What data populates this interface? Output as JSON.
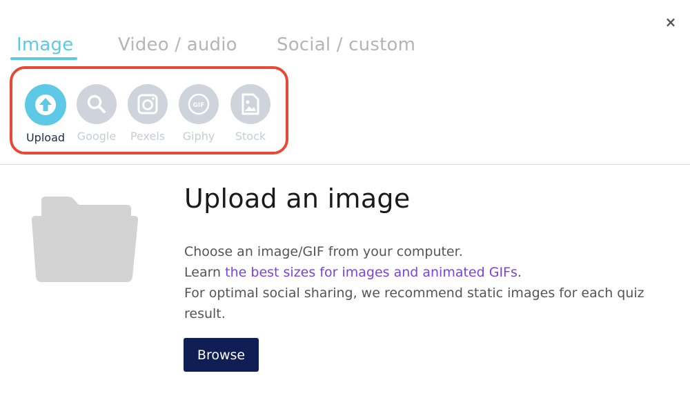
{
  "dialog": {
    "close_label": "×"
  },
  "tabs": [
    {
      "label": "Image",
      "active": true
    },
    {
      "label": "Video / audio",
      "active": false
    },
    {
      "label": "Social / custom",
      "active": false
    }
  ],
  "sources": [
    {
      "label": "Upload",
      "icon": "upload-icon",
      "active": true
    },
    {
      "label": "Google",
      "icon": "search-icon",
      "active": false
    },
    {
      "label": "Pexels",
      "icon": "camera-icon",
      "active": false
    },
    {
      "label": "Giphy",
      "icon": "gif-icon",
      "active": false
    },
    {
      "label": "Stock",
      "icon": "image-file-icon",
      "active": false
    }
  ],
  "upload": {
    "title": "Upload an image",
    "line1": "Choose an image/GIF from your computer.",
    "line2_prefix": "Learn ",
    "line2_link": "the best sizes for images and animated GIFs",
    "line2_suffix": ".",
    "line3": "For optimal social sharing, we recommend static images for each quiz result.",
    "browse_label": "Browse"
  },
  "colors": {
    "accent": "#5ec9e6",
    "inactive_icon": "#cfd3dc",
    "highlight_border": "#e64a35",
    "button_bg": "#0f1f55",
    "link": "#7b3fe4"
  }
}
